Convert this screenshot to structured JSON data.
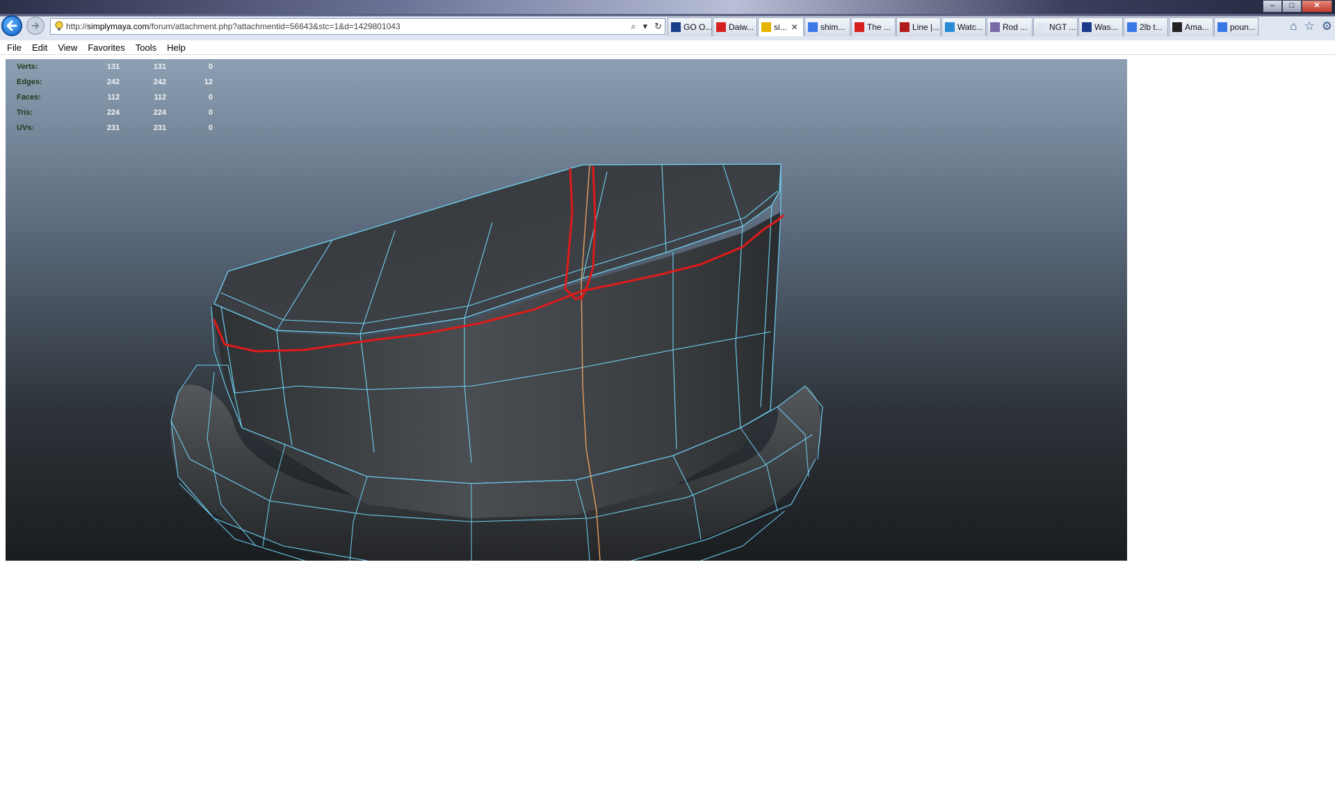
{
  "browser": {
    "url_prefix": "http://",
    "url_domain": "simplymaya.com",
    "url_path": "/forum/attachment.php?attachmentid=56643&stc=1&d=1429801043",
    "tabs": [
      {
        "label": "GO O...",
        "icon": "go-icon",
        "color": "#1b3f8b"
      },
      {
        "label": "Daiw...",
        "icon": "daiwa-icon",
        "color": "#d62020"
      },
      {
        "label": "si...",
        "icon": "bulb-icon",
        "color": "#e5b400",
        "active": true
      },
      {
        "label": "shim...",
        "icon": "google-icon",
        "color": "#3b78e7"
      },
      {
        "label": "The ...",
        "icon": "youtube-icon",
        "color": "#d81f1f"
      },
      {
        "label": "Line |...",
        "icon": "ad-icon",
        "color": "#b01b1b"
      },
      {
        "label": "Watc...",
        "icon": "ie-icon",
        "color": "#2a8bd6"
      },
      {
        "label": "Rod ...",
        "icon": "fish-icon",
        "color": "#7a6aa8"
      },
      {
        "label": "NGT ...",
        "icon": "blank-icon",
        "color": "#dfe6f1"
      },
      {
        "label": "Was...",
        "icon": "sf-icon",
        "color": "#1a3a8a"
      },
      {
        "label": "2lb t...",
        "icon": "google-icon",
        "color": "#3b78e7"
      },
      {
        "label": "Ama...",
        "icon": "amazon-icon",
        "color": "#222222"
      },
      {
        "label": "poun...",
        "icon": "google-icon",
        "color": "#3b78e7"
      }
    ],
    "menu": [
      "File",
      "Edit",
      "View",
      "Favorites",
      "Tools",
      "Help"
    ]
  },
  "hud": [
    {
      "label": "Verts:",
      "a": "131",
      "b": "131",
      "c": "0"
    },
    {
      "label": "Edges:",
      "a": "242",
      "b": "242",
      "c": "12"
    },
    {
      "label": "Faces:",
      "a": "112",
      "b": "112",
      "c": "0"
    },
    {
      "label": "Tris:",
      "a": "224",
      "b": "224",
      "c": "0"
    },
    {
      "label": "UVs:",
      "a": "231",
      "b": "231",
      "c": "0"
    }
  ],
  "colors": {
    "wire": "#6fd3f5",
    "seam": "#e8a060",
    "annotation": "#e01a1a",
    "mesh_dark": "#333639",
    "mesh_light": "#5a5d61"
  }
}
